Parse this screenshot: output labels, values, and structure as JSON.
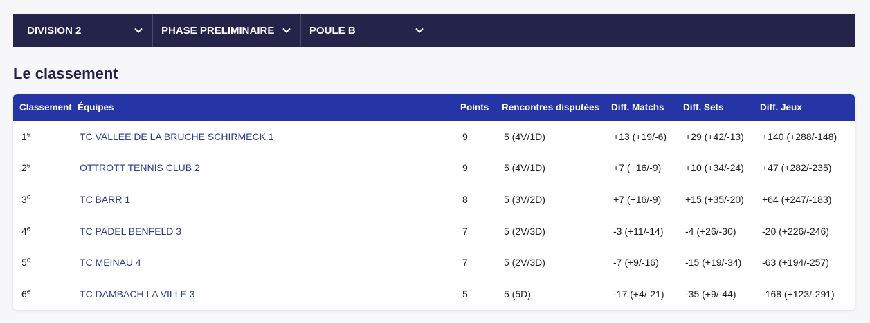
{
  "filters": {
    "division": "DIVISION 2",
    "phase": "PHASE PRELIMINAIRE",
    "poule": "POULE B"
  },
  "section_title": "Le classement",
  "table": {
    "headers": {
      "rank": "Classement",
      "team": "Équipes",
      "points": "Points",
      "rencontres": "Rencontres disputées",
      "diff_matchs": "Diff. Matchs",
      "diff_sets": "Diff. Sets",
      "diff_jeux": "Diff. Jeux"
    },
    "rows": [
      {
        "rank": "1",
        "sup": "e",
        "team": "TC VALLEE DE LA BRUCHE SCHIRMECK 1",
        "points": "9",
        "rencontres": "5 (4V/1D)",
        "diff_matchs": "+13 (+19/-6)",
        "diff_sets": "+29 (+42/-13)",
        "diff_jeux": "+140 (+288/-148)"
      },
      {
        "rank": "2",
        "sup": "e",
        "team": "OTTROTT TENNIS CLUB 2",
        "points": "9",
        "rencontres": "5 (4V/1D)",
        "diff_matchs": "+7 (+16/-9)",
        "diff_sets": "+10 (+34/-24)",
        "diff_jeux": "+47 (+282/-235)"
      },
      {
        "rank": "3",
        "sup": "e",
        "team": "TC BARR 1",
        "points": "8",
        "rencontres": "5 (3V/2D)",
        "diff_matchs": "+7 (+16/-9)",
        "diff_sets": "+15 (+35/-20)",
        "diff_jeux": "+64 (+247/-183)"
      },
      {
        "rank": "4",
        "sup": "e",
        "team": "TC PADEL BENFELD 3",
        "points": "7",
        "rencontres": "5 (2V/3D)",
        "diff_matchs": "-3 (+11/-14)",
        "diff_sets": "-4 (+26/-30)",
        "diff_jeux": "-20 (+226/-246)"
      },
      {
        "rank": "5",
        "sup": "e",
        "team": "TC MEINAU 4",
        "points": "7",
        "rencontres": "5 (2V/3D)",
        "diff_matchs": "-7 (+9/-16)",
        "diff_sets": "-15 (+19/-34)",
        "diff_jeux": "-63 (+194/-257)"
      },
      {
        "rank": "6",
        "sup": "e",
        "team": "TC DAMBACH LA VILLE 3",
        "points": "5",
        "rencontres": "5 (5D)",
        "diff_matchs": "-17 (+4/-21)",
        "diff_sets": "-35 (+9/-44)",
        "diff_jeux": "-168 (+123/-291)"
      }
    ]
  },
  "icons": {
    "dropdown": "chevron-down-icon"
  },
  "colors": {
    "filter_bg": "#24244b",
    "header_bg": "#2535a6",
    "link": "#2a3c96",
    "title": "#24244b"
  }
}
